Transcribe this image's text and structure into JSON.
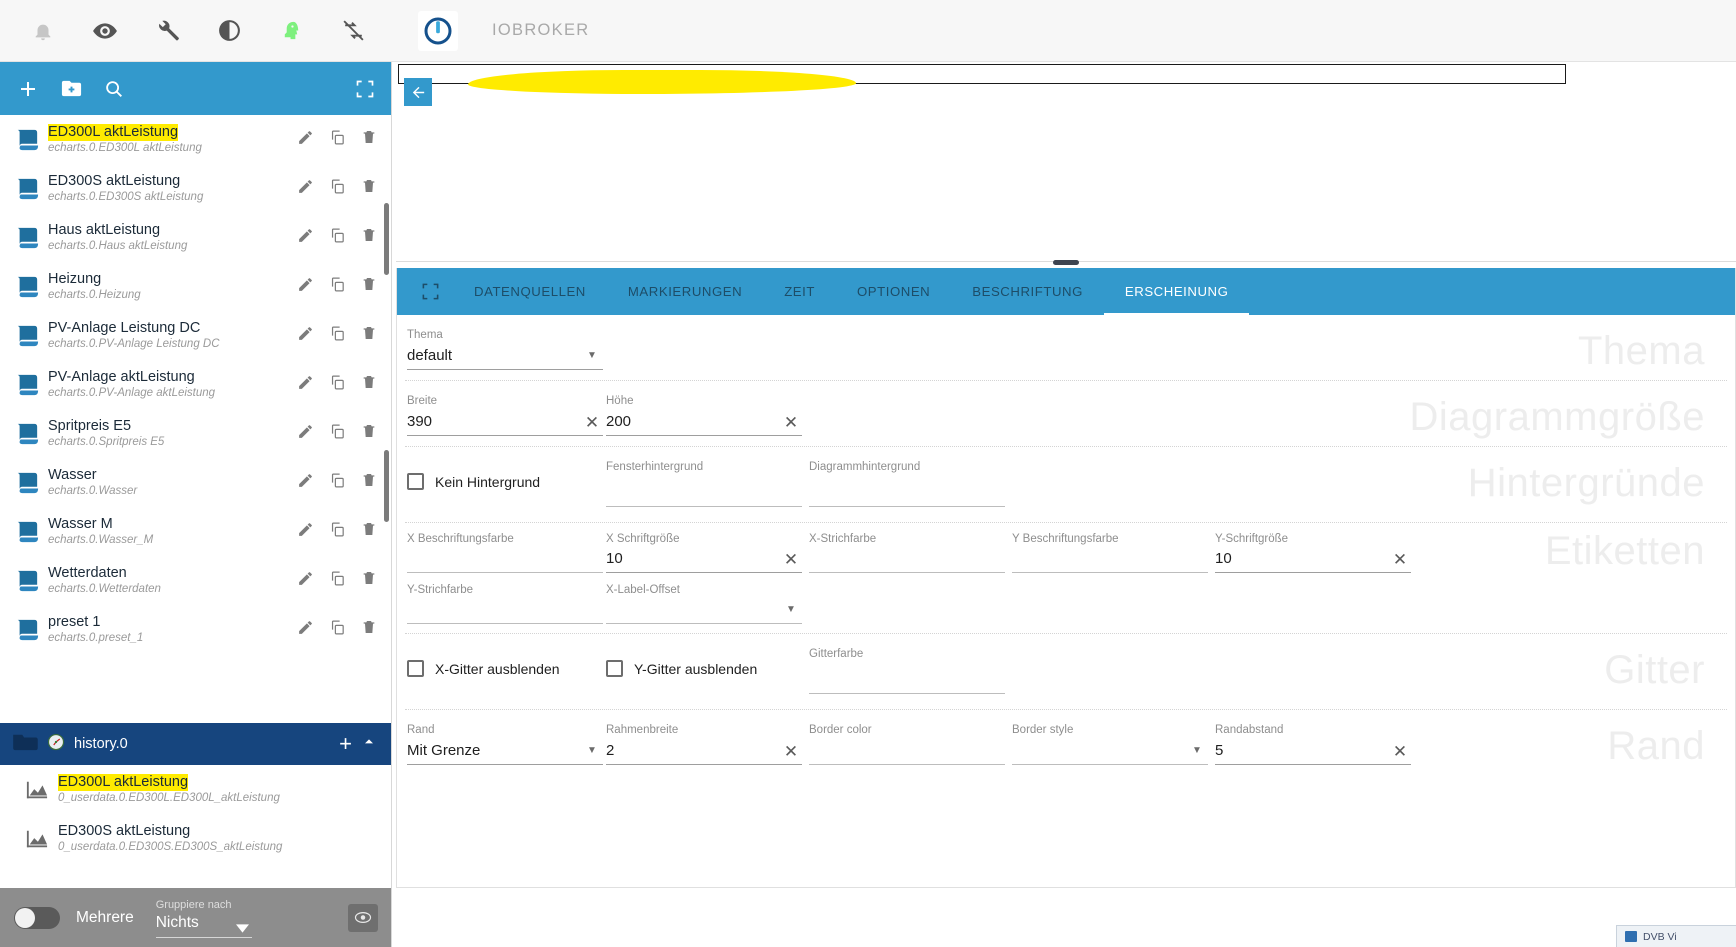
{
  "appbar": {
    "brand": "IOBROKER",
    "icons": [
      {
        "name": "bell-icon",
        "label": "Benachrichtigungen"
      },
      {
        "name": "eye-icon",
        "label": "Experten-Modus"
      },
      {
        "name": "wrench-icon",
        "label": "Einstellungen"
      },
      {
        "name": "contrast-icon",
        "label": "Theme"
      },
      {
        "name": "head-icon",
        "label": "Host aktiv"
      },
      {
        "name": "sync-off-icon",
        "label": "Synchronisierung aus"
      }
    ]
  },
  "sidebar": {
    "toolbar": {
      "add": "+",
      "add_folder": "add-folder",
      "search": "search",
      "expand": "expand"
    },
    "presets": [
      {
        "title": "ED300L aktLeistung",
        "path": "echarts.0.ED300L aktLeistung",
        "highlight": true
      },
      {
        "title": "ED300S aktLeistung",
        "path": "echarts.0.ED300S aktLeistung",
        "highlight": false
      },
      {
        "title": "Haus aktLeistung",
        "path": "echarts.0.Haus aktLeistung",
        "highlight": false
      },
      {
        "title": "Heizung",
        "path": "echarts.0.Heizung",
        "highlight": false
      },
      {
        "title": "PV-Anlage Leistung DC",
        "path": "echarts.0.PV-Anlage Leistung DC",
        "highlight": false
      },
      {
        "title": "PV-Anlage aktLeistung",
        "path": "echarts.0.PV-Anlage aktLeistung",
        "highlight": false
      },
      {
        "title": "Spritpreis E5",
        "path": "echarts.0.Spritpreis E5",
        "highlight": false
      },
      {
        "title": "Wasser",
        "path": "echarts.0.Wasser",
        "highlight": false
      },
      {
        "title": "Wasser M",
        "path": "echarts.0.Wasser_M",
        "highlight": false
      },
      {
        "title": "Wetterdaten",
        "path": "echarts.0.Wetterdaten",
        "highlight": false
      },
      {
        "title": "preset 1",
        "path": "echarts.0.preset_1",
        "highlight": false
      }
    ],
    "group": {
      "name": "history.0",
      "add": "+",
      "collapse": "chevron-up"
    },
    "history_items": [
      {
        "title": "ED300L aktLeistung",
        "path": "0_userdata.0.ED300L.ED300L_aktLeistung",
        "highlight": true
      },
      {
        "title": "ED300S aktLeistung",
        "path": "0_userdata.0.ED300S.ED300S_aktLeistung",
        "highlight": false
      }
    ],
    "footer": {
      "toggle_label": "Mehrere",
      "group_by_label": "Gruppiere nach",
      "group_by_value": "Nichts",
      "preview_button": "eye-icon"
    }
  },
  "main": {
    "tabs": [
      {
        "label": "DATENQUELLEN",
        "active": false
      },
      {
        "label": "MARKIERUNGEN",
        "active": false
      },
      {
        "label": "ZEIT",
        "active": false
      },
      {
        "label": "OPTIONEN",
        "active": false
      },
      {
        "label": "BESCHRIFTUNG",
        "active": false
      },
      {
        "label": "ERSCHEINUNG",
        "active": true
      }
    ],
    "expand_icon": "fullscreen-icon",
    "back_button": "back-arrow-icon",
    "watermarks": [
      "Thema",
      "Diagrammgröße",
      "Hintergründe",
      "Etiketten",
      "Gitter",
      "Rand"
    ],
    "fields": {
      "thema": {
        "label": "Thema",
        "value": "default"
      },
      "breite": {
        "label": "Breite",
        "value": "390"
      },
      "hoehe": {
        "label": "Höhe",
        "value": "200"
      },
      "kein_hintergrund": {
        "label": "Kein Hintergrund",
        "checked": false
      },
      "fensterhintergrund": {
        "label": "Fensterhintergrund",
        "value": ""
      },
      "diagrammhintergrund": {
        "label": "Diagrammhintergrund",
        "value": ""
      },
      "x_beschriftungsfarbe": {
        "label": "X Beschriftungsfarbe",
        "value": ""
      },
      "x_schriftgroesse": {
        "label": "X Schriftgröße",
        "value": "10"
      },
      "x_strichfarbe": {
        "label": "X-Strichfarbe",
        "value": ""
      },
      "y_beschriftungsfarbe": {
        "label": "Y Beschriftungsfarbe",
        "value": ""
      },
      "y_schriftgroesse": {
        "label": "Y-Schriftgröße",
        "value": "10"
      },
      "y_strichfarbe": {
        "label": "Y-Strichfarbe",
        "value": ""
      },
      "x_label_offset": {
        "label": "X-Label-Offset",
        "value": ""
      },
      "x_gitter_ausblenden": {
        "label": "X-Gitter ausblenden",
        "checked": false
      },
      "y_gitter_ausblenden": {
        "label": "Y-Gitter ausblenden",
        "checked": false
      },
      "gitterfarbe": {
        "label": "Gitterfarbe",
        "value": ""
      },
      "rand": {
        "label": "Rand",
        "value": "Mit Grenze"
      },
      "rahmenbreite": {
        "label": "Rahmenbreite",
        "value": "2"
      },
      "border_color": {
        "label": "Border color",
        "value": ""
      },
      "border_style": {
        "label": "Border style",
        "value": ""
      },
      "randabstand": {
        "label": "Randabstand",
        "value": "5"
      }
    }
  },
  "taskbar": {
    "label": "DVB Vi"
  },
  "colors": {
    "accent": "#3399cc",
    "group_header": "#16457e",
    "highlight": "#ffeb00"
  }
}
